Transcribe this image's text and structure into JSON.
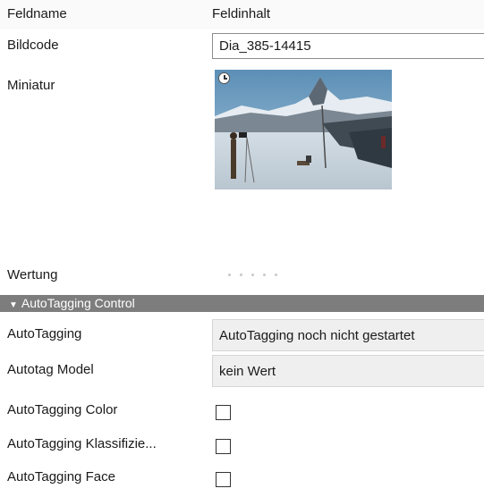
{
  "header": {
    "name_col": "Feldname",
    "value_col": "Feldinhalt"
  },
  "bildcode": {
    "label": "Bildcode",
    "value": "Dia_385-14415"
  },
  "miniatur": {
    "label": "Miniatur",
    "overlay_icon": "clock-icon"
  },
  "wertung": {
    "label": "Wertung",
    "rating": 0,
    "max": 5
  },
  "section": {
    "title": "AutoTagging Control",
    "collapse_icon": "triangle-down-icon"
  },
  "autotagging": {
    "label": "AutoTagging",
    "value": "AutoTagging noch nicht gestartet"
  },
  "autotag_model": {
    "label": "Autotag Model",
    "value": "kein Wert"
  },
  "autotagging_color": {
    "label": "AutoTagging Color",
    "checked": false
  },
  "autotagging_klass": {
    "label": "AutoTagging Klassifizie...",
    "checked": false
  },
  "autotagging_face": {
    "label": "AutoTagging Face",
    "checked": false
  }
}
